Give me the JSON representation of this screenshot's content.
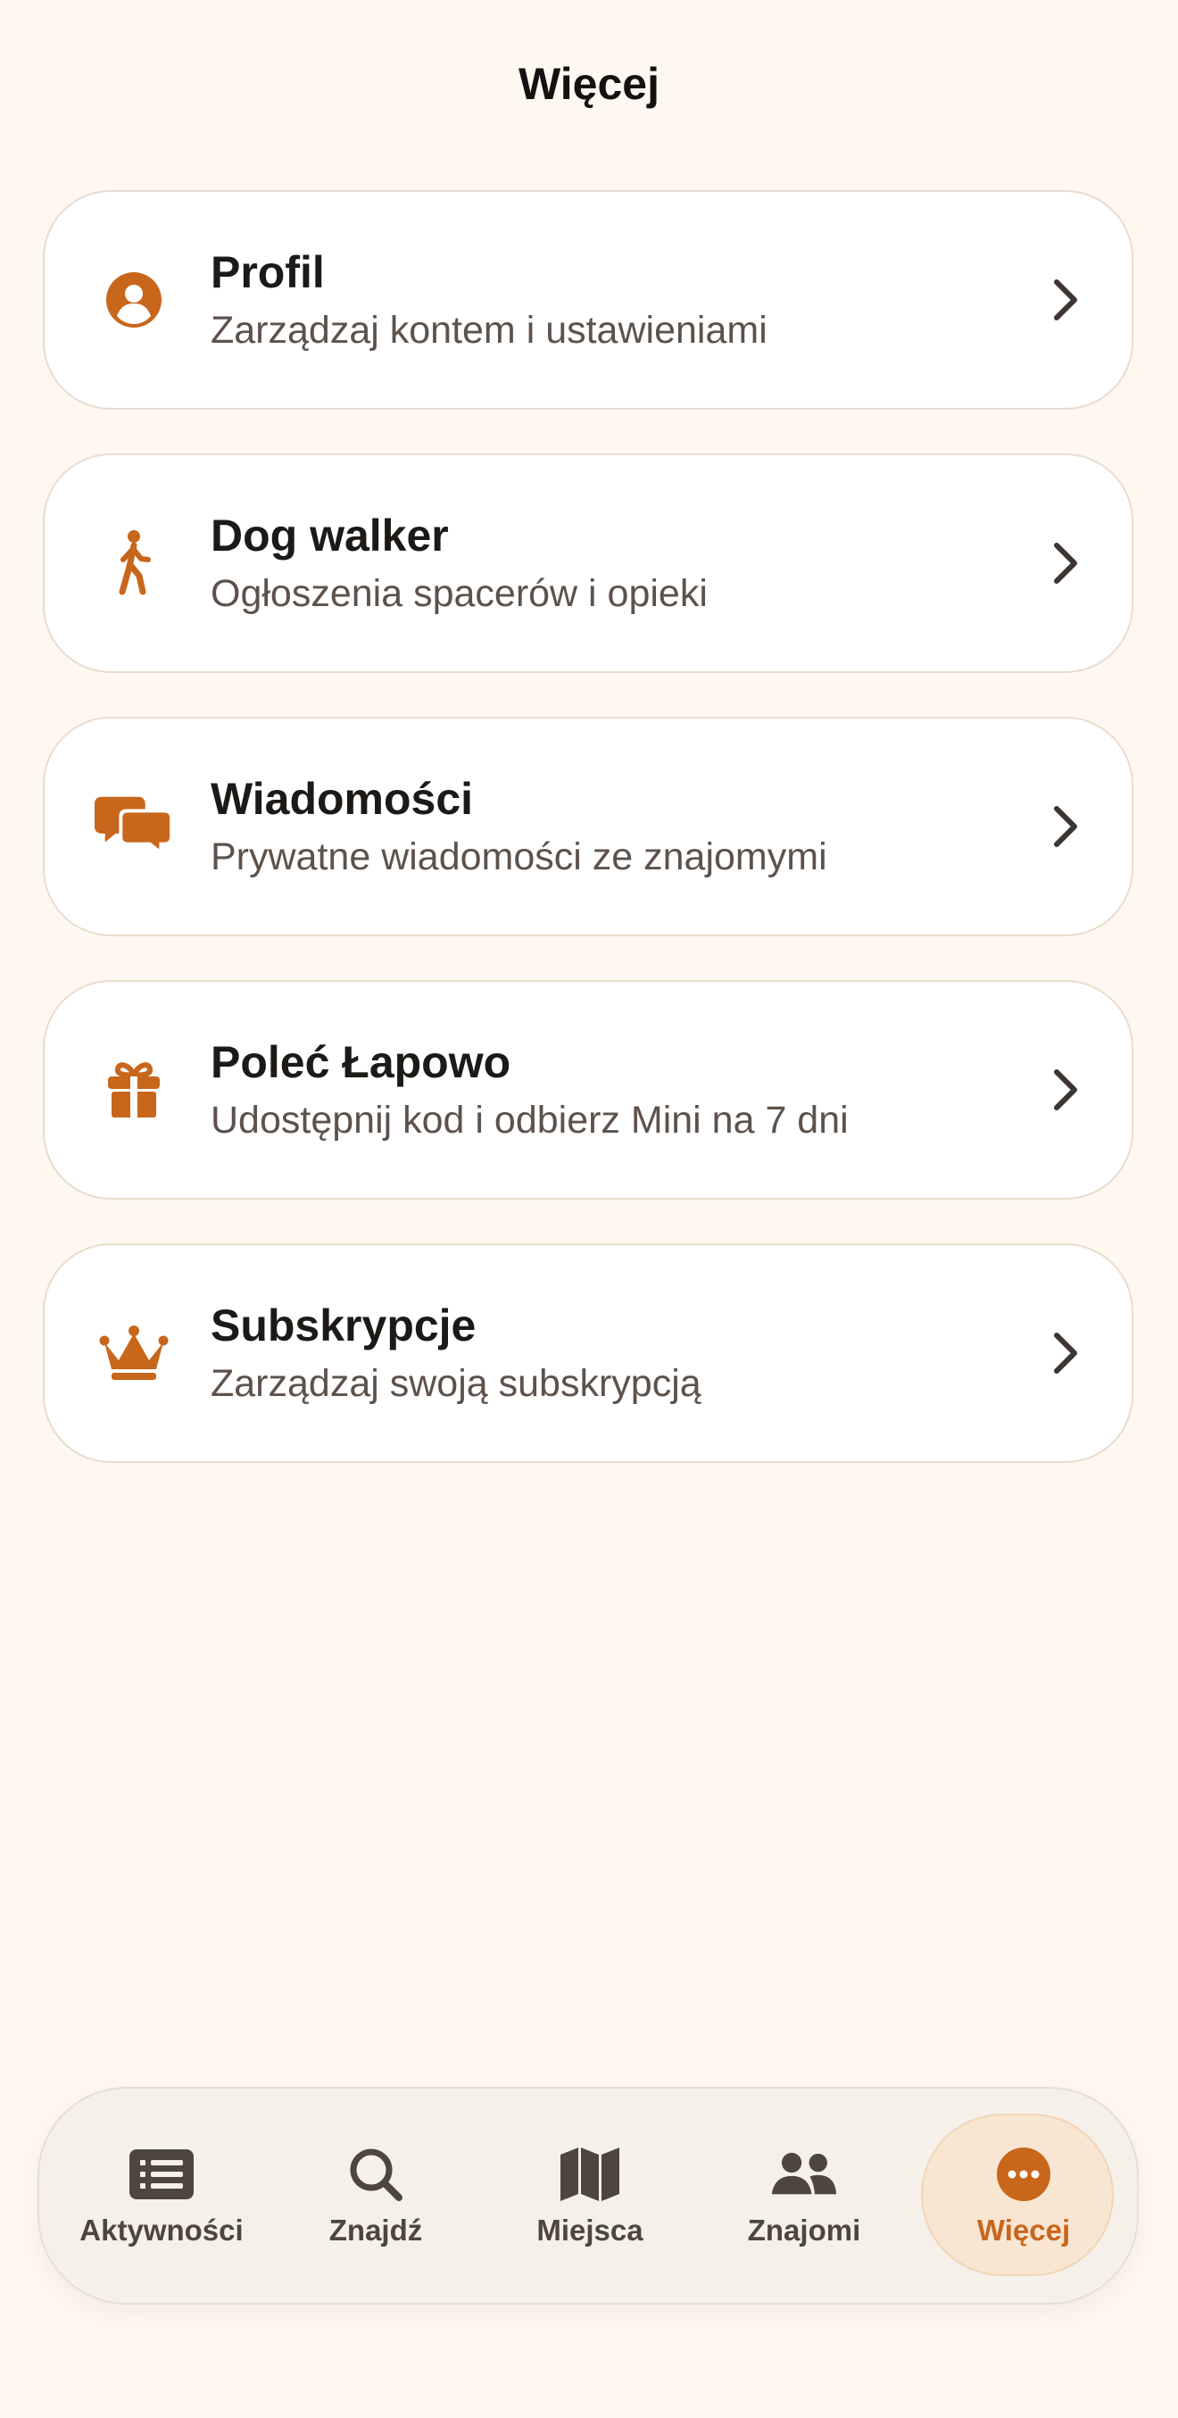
{
  "header": {
    "title": "Więcej"
  },
  "colors": {
    "accent": "#C8661C",
    "background": "#FFF8F1",
    "card": "#FFFFFF",
    "text_primary": "#1C1916",
    "text_secondary": "#5D524B"
  },
  "menu": {
    "items": [
      {
        "icon": "person-circle-icon",
        "title": "Profil",
        "subtitle": "Zarządzaj kontem i ustawieniami"
      },
      {
        "icon": "walking-person-icon",
        "title": "Dog walker",
        "subtitle": "Ogłoszenia spacerów i opieki"
      },
      {
        "icon": "chat-bubbles-icon",
        "title": "Wiadomości",
        "subtitle": "Prywatne wiadomości ze znajomymi"
      },
      {
        "icon": "gift-icon",
        "title": "Poleć Łapowo",
        "subtitle": "Udostępnij kod i odbierz Mini na 7 dni"
      },
      {
        "icon": "crown-icon",
        "title": "Subskrypcje",
        "subtitle": "Zarządzaj swoją subskrypcją"
      }
    ]
  },
  "tabbar": {
    "active": "Więcej",
    "tabs": [
      {
        "icon": "list-icon",
        "label": "Aktywności"
      },
      {
        "icon": "search-icon",
        "label": "Znajdź"
      },
      {
        "icon": "map-icon",
        "label": "Miejsca"
      },
      {
        "icon": "people-icon",
        "label": "Znajomi"
      },
      {
        "icon": "more-icon",
        "label": "Więcej"
      }
    ]
  }
}
